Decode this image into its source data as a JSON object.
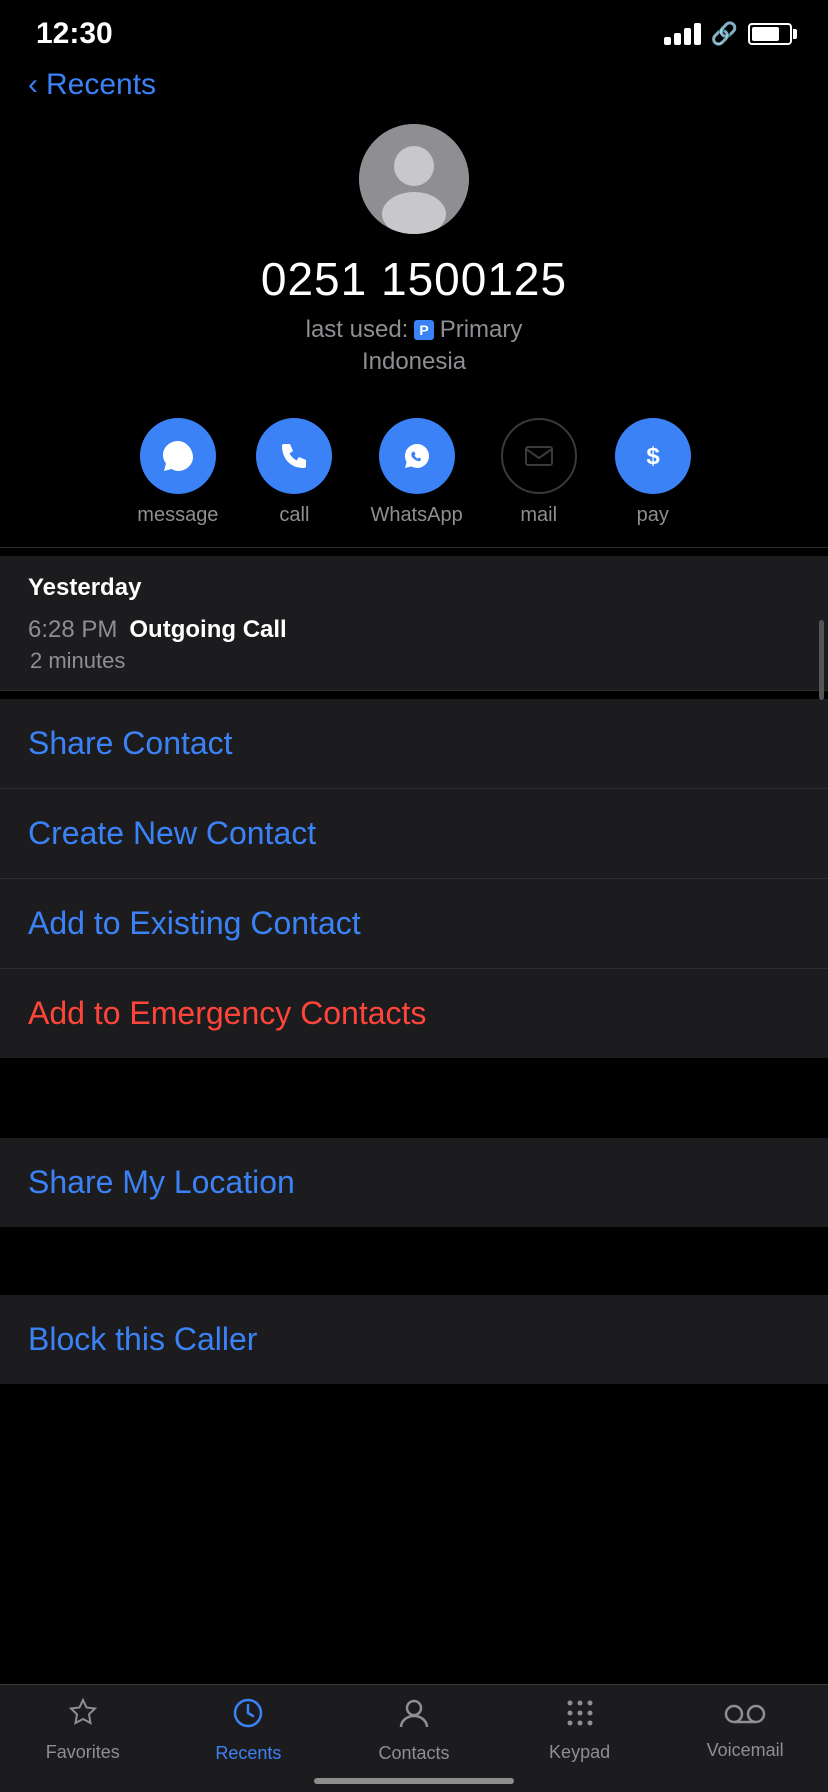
{
  "statusBar": {
    "time": "12:30",
    "battery": 75
  },
  "nav": {
    "backLabel": "Recents"
  },
  "contact": {
    "phoneNumber": "0251 1500125",
    "lastUsed": "last used:",
    "primaryBadge": "P",
    "primaryLabel": "Primary",
    "country": "Indonesia"
  },
  "actions": [
    {
      "label": "message",
      "icon": "message",
      "enabled": true
    },
    {
      "label": "call",
      "icon": "call",
      "enabled": true
    },
    {
      "label": "WhatsApp",
      "icon": "whatsapp",
      "enabled": true
    },
    {
      "label": "mail",
      "icon": "mail",
      "enabled": false
    },
    {
      "label": "pay",
      "icon": "pay",
      "enabled": true
    }
  ],
  "callHistory": {
    "date": "Yesterday",
    "time": "6:28 PM",
    "type": "Outgoing Call",
    "duration": "2 minutes"
  },
  "menuItems": [
    {
      "label": "Share Contact",
      "type": "normal"
    },
    {
      "label": "Create New Contact",
      "type": "normal"
    },
    {
      "label": "Add to Existing Contact",
      "type": "normal"
    },
    {
      "label": "Add to Emergency Contacts",
      "type": "danger"
    }
  ],
  "locationItem": {
    "label": "Share My Location"
  },
  "blockItem": {
    "label": "Block this Caller"
  },
  "tabBar": {
    "items": [
      {
        "label": "Favorites",
        "icon": "★",
        "active": false
      },
      {
        "label": "Recents",
        "icon": "🕐",
        "active": true
      },
      {
        "label": "Contacts",
        "icon": "👤",
        "active": false
      },
      {
        "label": "Keypad",
        "icon": "⠿",
        "active": false
      },
      {
        "label": "Voicemail",
        "icon": "⊙⊙",
        "active": false
      }
    ]
  }
}
